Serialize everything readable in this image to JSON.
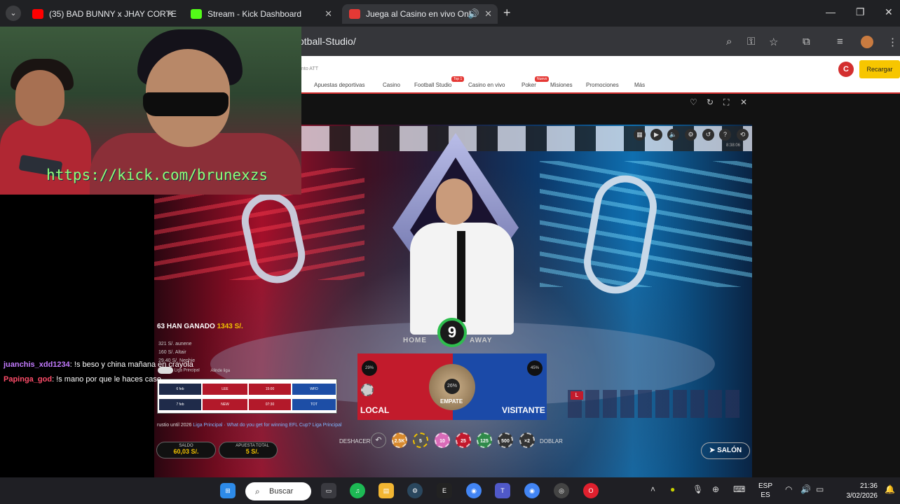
{
  "browser": {
    "tab_menu_icon": "chevron-down-icon",
    "tabs": [
      {
        "label": "(35) BAD BUNNY x JHAY CORTE",
        "favicon_color": "#ff0000"
      },
      {
        "label": "Stream - Kick Dashboard",
        "favicon_color": "#53fc18"
      },
      {
        "label": "Juega al Casino en vivo Onl",
        "favicon_color": "#e53935"
      }
    ],
    "new_tab": "+",
    "url": "otball-Studio/"
  },
  "site": {
    "subtext": "nto ATT",
    "nav": [
      "Apuestas deportivas",
      "Casino",
      "Football Studio",
      "Casino en vivo",
      "Poker",
      "Misiones",
      "Promociones",
      "Más"
    ],
    "badges": {
      "football": "Top 1",
      "poker": "Nuevo"
    },
    "user_initial": "C",
    "recargar": "Recargar"
  },
  "game": {
    "time": "8:38:06",
    "timer": "9",
    "home": "HOME",
    "away": "AWAY",
    "local_label": "LOCAL",
    "visitante_label": "VISITANTE",
    "empate_label": "EMPATE",
    "local_pct": "29%",
    "empate_pct": "26%",
    "visitante_pct": "45%",
    "road_first": "L",
    "winners_count": "63",
    "winners_label": "HAN GANADO",
    "winners_amount": "1343 S/.",
    "winners_list": [
      "321 S/. aunene",
      "160 S/. Altair",
      "29.40 S/. Nephie"
    ],
    "league_toggle": "Liga Principal",
    "league_toggle_right": "Alinde liga",
    "league_rows": [
      [
        "6 feb",
        "LEE",
        "15:00",
        "WFD"
      ],
      [
        "7 feb",
        "NEW",
        "07:30",
        "TOT"
      ]
    ],
    "ticker_white": "rustio until 2026",
    "ticker": "Liga Principal · What do you get for winning EFL Cup?",
    "ticker_end": "Liga Principal",
    "undo_label": "DESHACER",
    "double_label": "DOBLAR",
    "chips": [
      "2.5K",
      "5",
      "10",
      "25",
      "125",
      "500",
      "×2"
    ],
    "saldo_label": "SALDO",
    "saldo_value": "60,03 S/.",
    "apuesta_label": "APUESTA TOTAL",
    "apuesta_value": "5 S/.",
    "salon": "SALÓN"
  },
  "webcam": {
    "overlay_url": "https://kick.com/brunexzs"
  },
  "chat": [
    {
      "user": "juanchis_xdd1234",
      "msg": ": !s beso y china mañana en crayola"
    },
    {
      "user": "Papinga_god",
      "msg": ": !s mano por que le haces caso"
    }
  ],
  "taskbar": {
    "search": "Buscar",
    "lang1": "ESP",
    "lang2": "ES",
    "time": "21:36",
    "date": "3/02/2026"
  }
}
